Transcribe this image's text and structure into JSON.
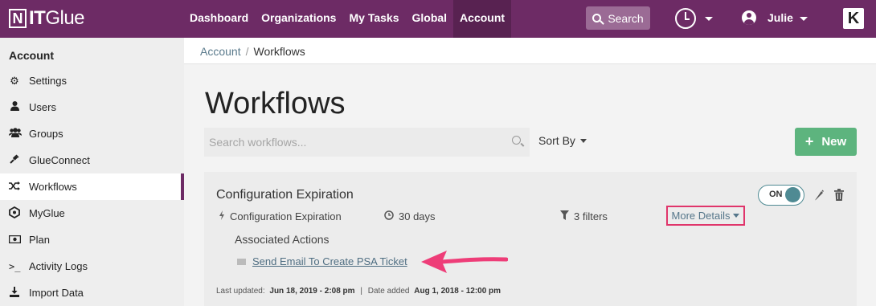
{
  "brand": {
    "logo_text_bold": "IT",
    "logo_text": "Glue",
    "mark": "N"
  },
  "nav": {
    "items": [
      {
        "label": "Dashboard"
      },
      {
        "label": "Organizations"
      },
      {
        "label": "My Tasks"
      },
      {
        "label": "Global"
      },
      {
        "label": "Account",
        "active": true
      }
    ],
    "search_label": "Search",
    "user_name": "Julie",
    "app_icon": "K"
  },
  "sidebar": {
    "title": "Account",
    "items": [
      {
        "label": "Settings",
        "icon": "gear-icon"
      },
      {
        "label": "Users",
        "icon": "user-icon"
      },
      {
        "label": "Groups",
        "icon": "users-icon"
      },
      {
        "label": "GlueConnect",
        "icon": "plug-icon"
      },
      {
        "label": "Workflows",
        "icon": "shuffle-icon",
        "active": true
      },
      {
        "label": "MyGlue",
        "icon": "hexagon-icon"
      },
      {
        "label": "Plan",
        "icon": "money-icon"
      },
      {
        "label": "Activity Logs",
        "icon": "terminal-icon"
      },
      {
        "label": "Import Data",
        "icon": "download-icon"
      }
    ]
  },
  "breadcrumb": {
    "parent": "Account",
    "separator": "/",
    "current": "Workflows"
  },
  "main": {
    "title": "Workflows",
    "search_placeholder": "Search workflows...",
    "sort_label": "Sort By",
    "new_label": "New"
  },
  "workflow": {
    "title": "Configuration Expiration",
    "trigger": "Configuration Expiration",
    "duration": "30 days",
    "filters": "3 filters",
    "more_details": "More Details",
    "toggle": "ON",
    "associated_label": "Associated Actions",
    "action_link": "Send Email To Create PSA Ticket",
    "last_updated_label": "Last updated:",
    "last_updated": "Jun 18, 2019 - 2:08 pm",
    "divider": "|",
    "date_added_label": "Date added",
    "date_added": "Aug 1, 2018 - 12:00 pm"
  },
  "colors": {
    "header": "#6d2b65",
    "accent_green": "#5db47e",
    "highlight": "#e0356b",
    "toggle": "#4f8a93"
  }
}
